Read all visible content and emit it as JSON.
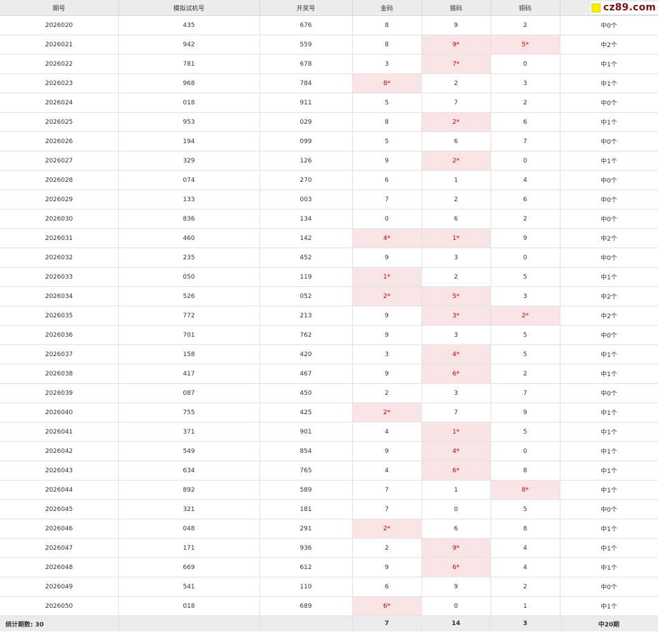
{
  "watermark": "cz89.com",
  "headers": [
    "期号",
    "模拟试机号",
    "开奖号",
    "金码",
    "银码",
    "铜码",
    ""
  ],
  "rows": [
    {
      "issue": "2026020",
      "sim": "435",
      "draw": "676",
      "jin": "8",
      "yin": "9",
      "tong": "2",
      "jin_hit": false,
      "yin_hit": false,
      "tong_hit": false,
      "result": "中0个"
    },
    {
      "issue": "2026021",
      "sim": "942",
      "draw": "559",
      "jin": "8",
      "yin": "9*",
      "tong": "5*",
      "jin_hit": false,
      "yin_hit": true,
      "tong_hit": true,
      "result": "中2个"
    },
    {
      "issue": "2026022",
      "sim": "781",
      "draw": "678",
      "jin": "3",
      "yin": "7*",
      "tong": "0",
      "jin_hit": false,
      "yin_hit": true,
      "tong_hit": false,
      "result": "中1个"
    },
    {
      "issue": "2026023",
      "sim": "968",
      "draw": "784",
      "jin": "8*",
      "yin": "2",
      "tong": "3",
      "jin_hit": true,
      "yin_hit": false,
      "tong_hit": false,
      "result": "中1个"
    },
    {
      "issue": "2026024",
      "sim": "018",
      "draw": "911",
      "jin": "5",
      "yin": "7",
      "tong": "2",
      "jin_hit": false,
      "yin_hit": false,
      "tong_hit": false,
      "result": "中0个"
    },
    {
      "issue": "2026025",
      "sim": "953",
      "draw": "029",
      "jin": "8",
      "yin": "2*",
      "tong": "6",
      "jin_hit": false,
      "yin_hit": true,
      "tong_hit": false,
      "result": "中1个"
    },
    {
      "issue": "2026026",
      "sim": "194",
      "draw": "099",
      "jin": "5",
      "yin": "6",
      "tong": "7",
      "jin_hit": false,
      "yin_hit": false,
      "tong_hit": false,
      "result": "中0个"
    },
    {
      "issue": "2026027",
      "sim": "329",
      "draw": "126",
      "jin": "9",
      "yin": "2*",
      "tong": "0",
      "jin_hit": false,
      "yin_hit": true,
      "tong_hit": false,
      "result": "中1个"
    },
    {
      "issue": "2026028",
      "sim": "074",
      "draw": "270",
      "jin": "6",
      "yin": "1",
      "tong": "4",
      "jin_hit": false,
      "yin_hit": false,
      "tong_hit": false,
      "result": "中0个"
    },
    {
      "issue": "2026029",
      "sim": "133",
      "draw": "003",
      "jin": "7",
      "yin": "2",
      "tong": "6",
      "jin_hit": false,
      "yin_hit": false,
      "tong_hit": false,
      "result": "中0个"
    },
    {
      "issue": "2026030",
      "sim": "836",
      "draw": "134",
      "jin": "0",
      "yin": "6",
      "tong": "2",
      "jin_hit": false,
      "yin_hit": false,
      "tong_hit": false,
      "result": "中0个"
    },
    {
      "issue": "2026031",
      "sim": "460",
      "draw": "142",
      "jin": "4*",
      "yin": "1*",
      "tong": "9",
      "jin_hit": true,
      "yin_hit": true,
      "tong_hit": false,
      "result": "中2个"
    },
    {
      "issue": "2026032",
      "sim": "235",
      "draw": "452",
      "jin": "9",
      "yin": "3",
      "tong": "0",
      "jin_hit": false,
      "yin_hit": false,
      "tong_hit": false,
      "result": "中0个"
    },
    {
      "issue": "2026033",
      "sim": "050",
      "draw": "119",
      "jin": "1*",
      "yin": "2",
      "tong": "5",
      "jin_hit": true,
      "yin_hit": false,
      "tong_hit": false,
      "result": "中1个"
    },
    {
      "issue": "2026034",
      "sim": "526",
      "draw": "052",
      "jin": "2*",
      "yin": "5*",
      "tong": "3",
      "jin_hit": true,
      "yin_hit": true,
      "tong_hit": false,
      "result": "中2个"
    },
    {
      "issue": "2026035",
      "sim": "772",
      "draw": "213",
      "jin": "9",
      "yin": "3*",
      "tong": "2*",
      "jin_hit": false,
      "yin_hit": true,
      "tong_hit": true,
      "result": "中2个"
    },
    {
      "issue": "2026036",
      "sim": "701",
      "draw": "762",
      "jin": "9",
      "yin": "3",
      "tong": "5",
      "jin_hit": false,
      "yin_hit": false,
      "tong_hit": false,
      "result": "中0个"
    },
    {
      "issue": "2026037",
      "sim": "158",
      "draw": "420",
      "jin": "3",
      "yin": "4*",
      "tong": "5",
      "jin_hit": false,
      "yin_hit": true,
      "tong_hit": false,
      "result": "中1个"
    },
    {
      "issue": "2026038",
      "sim": "417",
      "draw": "467",
      "jin": "9",
      "yin": "6*",
      "tong": "2",
      "jin_hit": false,
      "yin_hit": true,
      "tong_hit": false,
      "result": "中1个"
    },
    {
      "issue": "2026039",
      "sim": "087",
      "draw": "450",
      "jin": "2",
      "yin": "3",
      "tong": "7",
      "jin_hit": false,
      "yin_hit": false,
      "tong_hit": false,
      "result": "中0个"
    },
    {
      "issue": "2026040",
      "sim": "755",
      "draw": "425",
      "jin": "2*",
      "yin": "7",
      "tong": "9",
      "jin_hit": true,
      "yin_hit": false,
      "tong_hit": false,
      "result": "中1个"
    },
    {
      "issue": "2026041",
      "sim": "371",
      "draw": "901",
      "jin": "4",
      "yin": "1*",
      "tong": "5",
      "jin_hit": false,
      "yin_hit": true,
      "tong_hit": false,
      "result": "中1个"
    },
    {
      "issue": "2026042",
      "sim": "549",
      "draw": "854",
      "jin": "9",
      "yin": "4*",
      "tong": "0",
      "jin_hit": false,
      "yin_hit": true,
      "tong_hit": false,
      "result": "中1个"
    },
    {
      "issue": "2026043",
      "sim": "634",
      "draw": "765",
      "jin": "4",
      "yin": "6*",
      "tong": "8",
      "jin_hit": false,
      "yin_hit": true,
      "tong_hit": false,
      "result": "中1个"
    },
    {
      "issue": "2026044",
      "sim": "892",
      "draw": "589",
      "jin": "7",
      "yin": "1",
      "tong": "8*",
      "jin_hit": false,
      "yin_hit": false,
      "tong_hit": true,
      "result": "中1个"
    },
    {
      "issue": "2026045",
      "sim": "321",
      "draw": "181",
      "jin": "7",
      "yin": "0",
      "tong": "5",
      "jin_hit": false,
      "yin_hit": false,
      "tong_hit": false,
      "result": "中0个"
    },
    {
      "issue": "2026046",
      "sim": "048",
      "draw": "291",
      "jin": "2*",
      "yin": "6",
      "tong": "8",
      "jin_hit": true,
      "yin_hit": false,
      "tong_hit": false,
      "result": "中1个"
    },
    {
      "issue": "2026047",
      "sim": "171",
      "draw": "936",
      "jin": "2",
      "yin": "9*",
      "tong": "4",
      "jin_hit": false,
      "yin_hit": true,
      "tong_hit": false,
      "result": "中1个"
    },
    {
      "issue": "2026048",
      "sim": "669",
      "draw": "612",
      "jin": "9",
      "yin": "6*",
      "tong": "4",
      "jin_hit": false,
      "yin_hit": true,
      "tong_hit": false,
      "result": "中1个"
    },
    {
      "issue": "2026049",
      "sim": "541",
      "draw": "110",
      "jin": "6",
      "yin": "9",
      "tong": "2",
      "jin_hit": false,
      "yin_hit": false,
      "tong_hit": false,
      "result": "中0个"
    },
    {
      "issue": "2026050",
      "sim": "018",
      "draw": "689",
      "jin": "6*",
      "yin": "0",
      "tong": "1",
      "jin_hit": true,
      "yin_hit": false,
      "tong_hit": false,
      "result": "中1个"
    }
  ],
  "footer": {
    "label": "统计期数: 30",
    "jin_total": "7",
    "yin_total": "14",
    "tong_total": "3",
    "result_total": "中20期"
  },
  "colors": {
    "hit_bg": "#f9e4e5",
    "hit_text": "#c00000",
    "header_bg": "#ececec"
  }
}
